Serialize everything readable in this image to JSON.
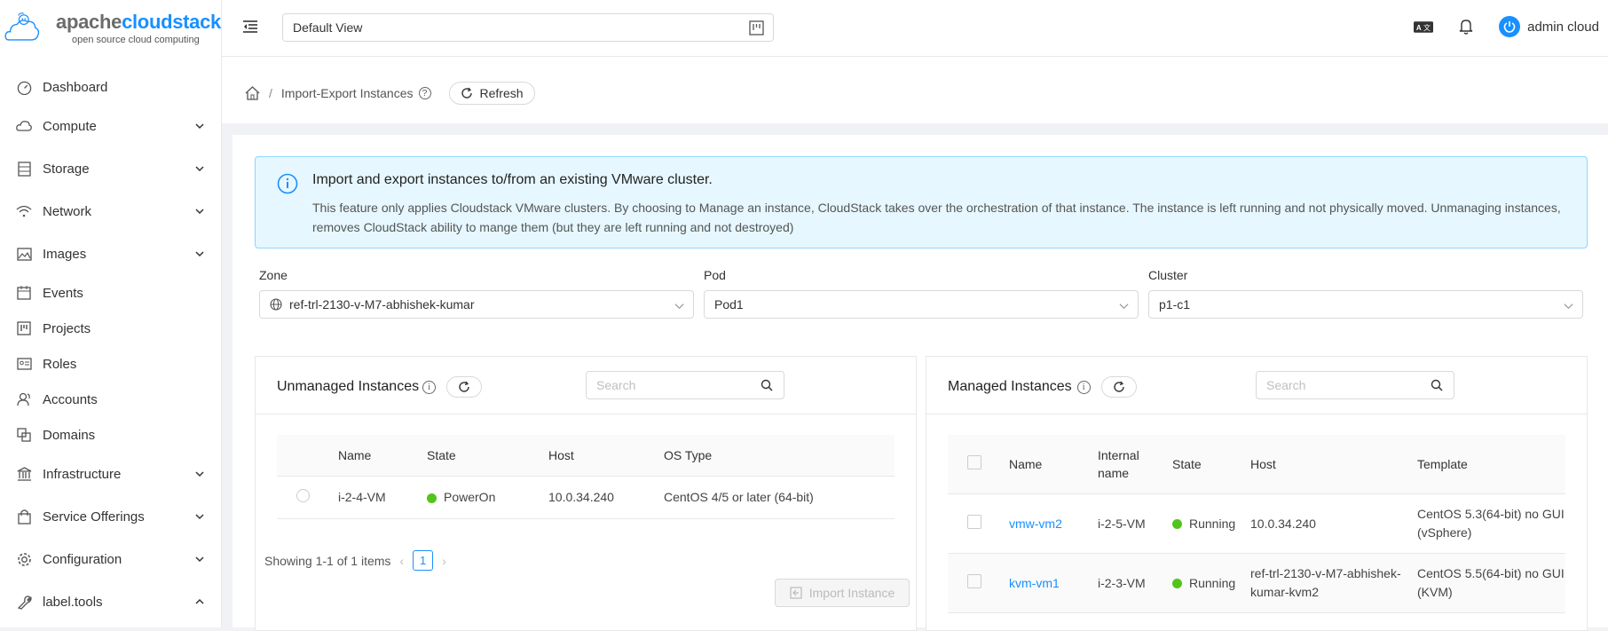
{
  "app": {
    "logo_word1": "apache",
    "logo_word2": "cloudstack",
    "logo_tagline": "open source cloud computing"
  },
  "sidebar": {
    "items": [
      {
        "label": "Dashboard",
        "icon": "dashboard-icon",
        "expandable": false
      },
      {
        "label": "Compute",
        "icon": "cloud-icon",
        "expandable": true
      },
      {
        "label": "Storage",
        "icon": "database-icon",
        "expandable": true
      },
      {
        "label": "Network",
        "icon": "wifi-icon",
        "expandable": true
      },
      {
        "label": "Images",
        "icon": "picture-icon",
        "expandable": true
      },
      {
        "label": "Events",
        "icon": "schedule-icon",
        "expandable": false
      },
      {
        "label": "Projects",
        "icon": "project-icon",
        "expandable": false
      },
      {
        "label": "Roles",
        "icon": "idcard-icon",
        "expandable": false
      },
      {
        "label": "Accounts",
        "icon": "team-icon",
        "expandable": false
      },
      {
        "label": "Domains",
        "icon": "block-icon",
        "expandable": false
      },
      {
        "label": "Infrastructure",
        "icon": "bank-icon",
        "expandable": true
      },
      {
        "label": "Service Offerings",
        "icon": "shopping-icon",
        "expandable": true
      },
      {
        "label": "Configuration",
        "icon": "setting-icon",
        "expandable": true
      },
      {
        "label": "label.tools",
        "icon": "tool-icon",
        "expandable": true
      }
    ]
  },
  "header": {
    "view_select": "Default View",
    "user_name": "admin cloud"
  },
  "breadcrumb": {
    "page": "Import-Export Instances",
    "refresh_label": "Refresh"
  },
  "alert": {
    "title": "Import and export instances to/from an existing VMware cluster.",
    "description": "This feature only applies Cloudstack VMware clusters. By choosing to Manage an instance, CloudStack takes over the orchestration of that instance. The instance is left running and not physically moved. Unmanaging instances, removes CloudStack ability to mange them (but they are left running and not destroyed)"
  },
  "filters": {
    "zone_label": "Zone",
    "zone_value": "ref-trl-2130-v-M7-abhishek-kumar",
    "pod_label": "Pod",
    "pod_value": "Pod1",
    "cluster_label": "Cluster",
    "cluster_value": "p1-c1"
  },
  "unmanaged": {
    "title": "Unmanaged Instances",
    "search_placeholder": "Search",
    "columns": [
      "Name",
      "State",
      "Host",
      "OS Type"
    ],
    "rows": [
      {
        "name": "i-2-4-VM",
        "state": "PowerOn",
        "host": "10.0.34.240",
        "os": "CentOS 4/5 or later (64-bit)"
      }
    ],
    "pager_text": "Showing 1-1 of 1 items",
    "page": "1",
    "import_label": "Import Instance"
  },
  "managed": {
    "title": "Managed Instances",
    "search_placeholder": "Search",
    "columns": [
      "Name",
      "Internal name",
      "State",
      "Host",
      "Template"
    ],
    "rows": [
      {
        "name": "vmw-vm2",
        "internal": "i-2-5-VM",
        "state": "Running",
        "host": "10.0.34.240",
        "template": "CentOS 5.3(64-bit) no GUI (vSphere)"
      },
      {
        "name": "kvm-vm1",
        "internal": "i-2-3-VM",
        "state": "Running",
        "host": "ref-trl-2130-v-M7-abhishek-kumar-kvm2",
        "template": "CentOS 5.5(64-bit) no GUI (KVM)"
      }
    ]
  },
  "colors": {
    "accent": "#1890ff",
    "success": "#52c41a",
    "alert_bg": "#e6f7ff"
  }
}
